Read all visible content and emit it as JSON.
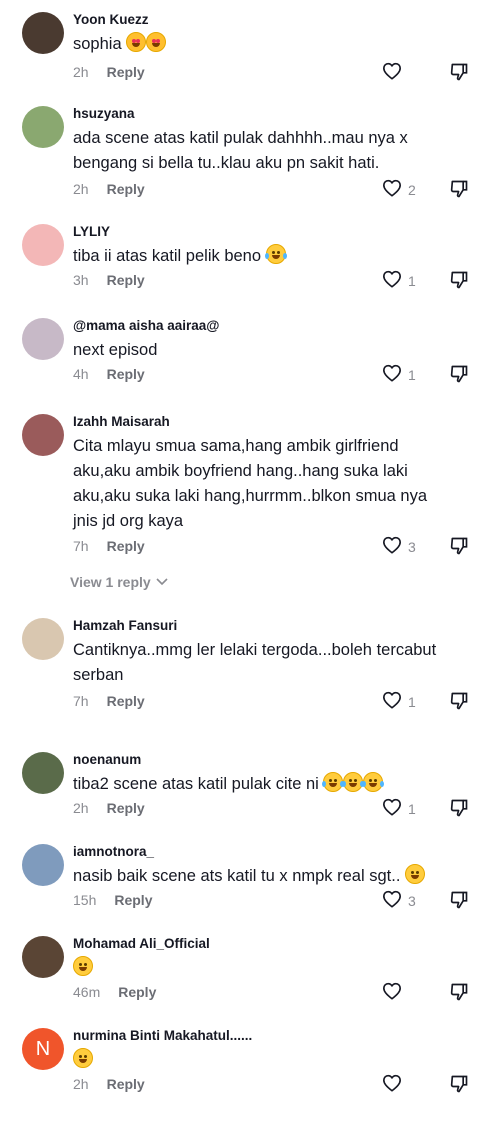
{
  "comments": [
    {
      "username": "Yoon Kuezz",
      "text": "sophia",
      "time": "2h",
      "reply": "Reply",
      "likes": "",
      "avatar_color": "#4a3a30",
      "emoji": [
        "love",
        "love"
      ]
    },
    {
      "username": "hsuzyana",
      "text": "ada scene atas katil pulak dahhhh..mau nya x bengang si bella tu..klau aku pn sakit hati.",
      "time": "2h",
      "reply": "Reply",
      "likes": "2",
      "avatar_color": "#8aa870",
      "emoji": []
    },
    {
      "username": "LYLIY",
      "text": "tiba ii atas katil pelik beno",
      "time": "3h",
      "reply": "Reply",
      "likes": "1",
      "avatar_color": "#f3b7b7",
      "emoji": [
        "tears"
      ]
    },
    {
      "username": "@mama aisha aairaa@",
      "text": "next episod",
      "time": "4h",
      "reply": "Reply",
      "likes": "1",
      "avatar_color": "#c7b9c7",
      "emoji": []
    },
    {
      "username": "Izahh Maisarah",
      "text": "Cita mlayu smua sama,hang ambik girlfriend aku,aku ambik boyfriend hang..hang suka laki aku,aku suka laki hang,hurrmm..blkon smua nya jnis jd org kaya",
      "time": "7h",
      "reply": "Reply",
      "likes": "3",
      "avatar_color": "#9a5b5b",
      "emoji": []
    },
    {
      "username": "Hamzah Fansuri",
      "text": "Cantiknya..mmg ler lelaki tergoda...boleh tercabut serban",
      "time": "7h",
      "reply": "Reply",
      "likes": "1",
      "avatar_color": "#d9c7b0",
      "emoji": []
    },
    {
      "username": "noenanum",
      "text": "tiba2 scene atas katil pulak cite ni",
      "time": "2h",
      "reply": "Reply",
      "likes": "1",
      "avatar_color": "#5a6b4a",
      "emoji": [
        "tears",
        "tears",
        "tears"
      ]
    },
    {
      "username": "iamnotnora_",
      "text": "nasib baik scene ats katil tu x nmpk real sgt..",
      "time": "15h",
      "reply": "Reply",
      "likes": "3",
      "avatar_color": "#7f9bbd",
      "emoji": [
        "sweat"
      ]
    },
    {
      "username": "Mohamad Ali_Official",
      "text": "",
      "time": "46m",
      "reply": "Reply",
      "likes": "",
      "avatar_color": "#5a4535",
      "emoji": [
        "grin"
      ]
    },
    {
      "username": "nurmina Binti Makahatul......",
      "text": "",
      "time": "2h",
      "reply": "Reply",
      "likes": "",
      "avatar_letter": "N",
      "avatar_color": "#f0552b",
      "emoji": [
        "sweat"
      ]
    }
  ],
  "view_replies": {
    "label": "View 1 reply"
  }
}
